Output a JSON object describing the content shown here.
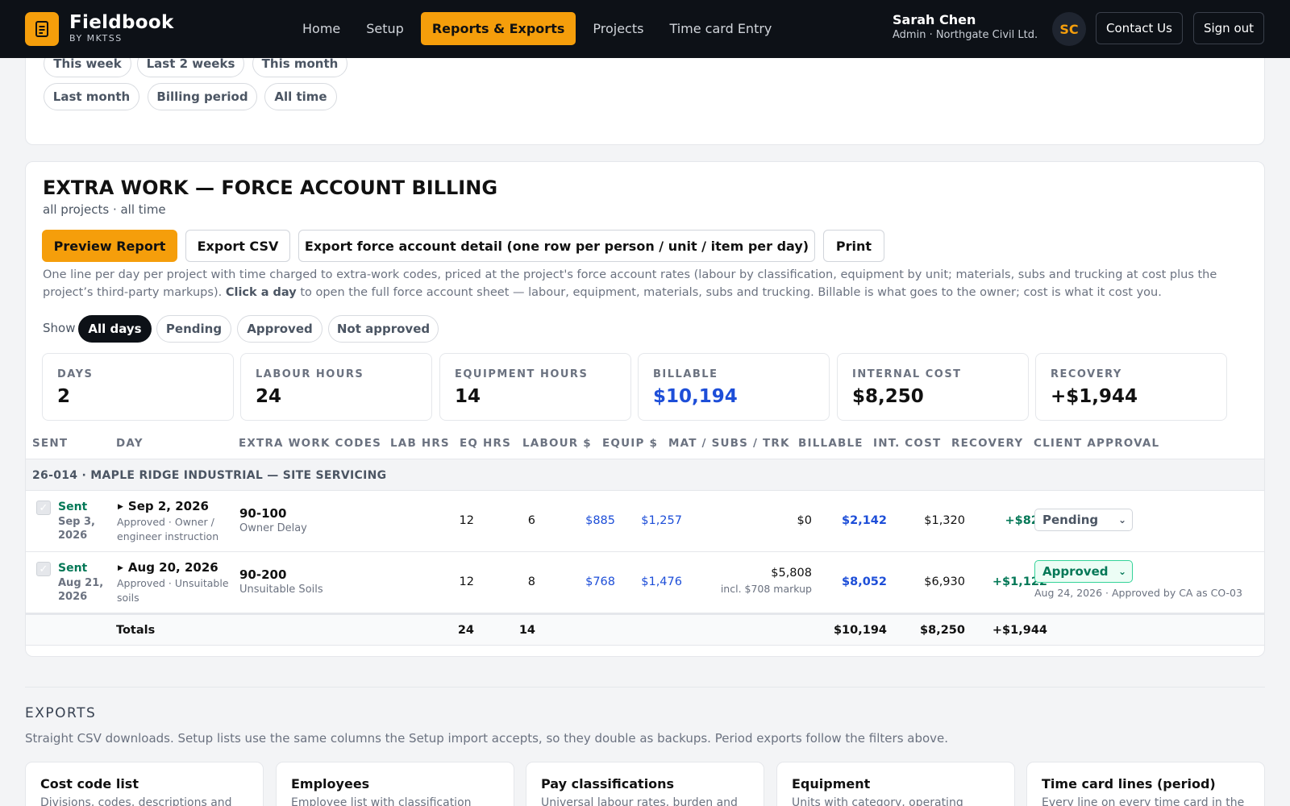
{
  "app": {
    "name": "Fieldbook",
    "sub": "BY MKTSS",
    "icon": "document-icon"
  },
  "nav": [
    "Home",
    "Setup",
    "Reports & Exports",
    "Projects",
    "Time card Entry"
  ],
  "nav_active": "Reports & Exports",
  "user": {
    "name": "Sarah Chen",
    "role": "Admin · Northgate Civil Ltd.",
    "initials": "SC"
  },
  "top_buttons": {
    "contact": "Contact Us",
    "signout": "Sign out"
  },
  "period_chips": [
    "This week",
    "Last 2 weeks",
    "This month",
    "Last month",
    "Billing period",
    "All time"
  ],
  "report": {
    "title": "EXTRA WORK — FORCE ACCOUNT BILLING",
    "subtitle": "all projects · all time",
    "buttons": {
      "preview": "Preview Report",
      "export_csv": "Export CSV",
      "export_detail": "Export force account detail (one row per person / unit / item per day)",
      "print": "Print"
    },
    "desc_1": "One line per day per project with time charged to extra-work codes, priced at the project's force account rates (labour by classification, equipment by unit; materials, subs and trucking at cost plus the project’s third-party markups).",
    "desc_bold": "Click a day",
    "desc_2": "to open the full force account sheet — labour, equipment, materials, subs and trucking. Billable is what goes to the owner; cost is what it cost you.",
    "show_label": "Show",
    "filters": [
      "All days",
      "Pending",
      "Approved",
      "Not approved"
    ],
    "filter_active": "All days",
    "stats": [
      {
        "label": "DAYS",
        "value": "2"
      },
      {
        "label": "LABOUR HOURS",
        "value": "24"
      },
      {
        "label": "EQUIPMENT HOURS",
        "value": "14"
      },
      {
        "label": "BILLABLE",
        "value": "$10,194"
      },
      {
        "label": "INTERNAL COST",
        "value": "$8,250"
      },
      {
        "label": "RECOVERY",
        "value": "+$1,944"
      }
    ],
    "columns": [
      "SENT",
      "DAY",
      "EXTRA WORK CODES",
      "LAB HRS",
      "EQ HRS",
      "LABOUR $",
      "EQUIP $",
      "MAT / SUBS / TRK",
      "BILLABLE",
      "INT. COST",
      "RECOVERY",
      "CLIENT APPROVAL"
    ],
    "group": "26-014 · MAPLE RIDGE INDUSTRIAL — SITE SERVICING",
    "rows": [
      {
        "sent": "Sent",
        "sent_date": "Sep 3, 2026",
        "day": "Sep 2, 2026",
        "day_sub": "Approved · Owner / engineer instruction",
        "code": "90-100",
        "code_sub": "Owner Delay",
        "lab_hrs": "12",
        "eq_hrs": "6",
        "labour": "$885",
        "equip": "$1,257",
        "mat": "$0",
        "mat_sub": "",
        "billable": "$2,142",
        "int_cost": "$1,320",
        "recovery": "+$822",
        "approval": "Pending",
        "approval_note": ""
      },
      {
        "sent": "Sent",
        "sent_date": "Aug 21, 2026",
        "day": "Aug 20, 2026",
        "day_sub": "Approved · Unsuitable soils",
        "code": "90-200",
        "code_sub": "Unsuitable Soils",
        "lab_hrs": "12",
        "eq_hrs": "8",
        "labour": "$768",
        "equip": "$1,476",
        "mat": "$5,808",
        "mat_sub": "incl. $708 markup",
        "billable": "$8,052",
        "int_cost": "$6,930",
        "recovery": "+$1,122",
        "approval": "Approved",
        "approval_note": "Aug 24, 2026 · Approved by CA as CO-03"
      }
    ],
    "totals": {
      "label": "Totals",
      "lab_hrs": "24",
      "eq_hrs": "14",
      "billable": "$10,194",
      "int_cost": "$8,250",
      "recovery": "+$1,944"
    }
  },
  "exports": {
    "title": "EXPORTS",
    "desc": "Straight CSV downloads. Setup lists use the same columns the Setup import accepts, so they double as backups. Period exports follow the filters above.",
    "cards": [
      {
        "title": "Cost code list",
        "desc": "Divisions, codes, descriptions and"
      },
      {
        "title": "Employees",
        "desc": "Employee list with classification"
      },
      {
        "title": "Pay classifications",
        "desc": "Universal labour rates, burden and"
      },
      {
        "title": "Equipment",
        "desc": "Units with category, operating"
      },
      {
        "title": "Time card lines (period)",
        "desc": "Every line on every time card in the"
      }
    ]
  },
  "colors": {
    "accent": "#f59e0b",
    "nav_bg": "#0d1117",
    "billable_blue": "#1d4ed8",
    "recovery_green": "#047857"
  }
}
